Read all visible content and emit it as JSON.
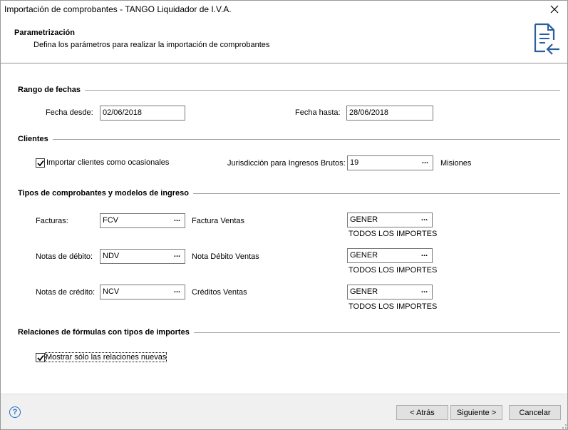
{
  "window": {
    "title": "Importación de comprobantes - TANGO Liquidador de I.V.A."
  },
  "header": {
    "title": "Parametrización",
    "subtitle": "Defina los parámetros para realizar la importación de comprobantes"
  },
  "rango_fechas": {
    "title": "Rango de fechas",
    "desde_label": "Fecha desde:",
    "desde_value": "02/06/2018",
    "hasta_label": "Fecha hasta:",
    "hasta_value": "28/06/2018"
  },
  "clientes": {
    "title": "Clientes",
    "importar_label": "Importar clientes como ocasionales",
    "importar_checked": true,
    "jurisdiccion_label": "Jurisdicción para Ingresos Brutos:",
    "jurisdiccion_value": "19",
    "jurisdiccion_desc": "Misiones"
  },
  "tipos": {
    "title": "Tipos de comprobantes y modelos de ingreso",
    "rows": [
      {
        "label": "Facturas:",
        "code": "FCV",
        "desc": "Factura Ventas",
        "modelo": "GENER",
        "modelo_desc": "TODOS LOS IMPORTES"
      },
      {
        "label": "Notas de débito:",
        "code": "NDV",
        "desc": "Nota Débito Ventas",
        "modelo": "GENER",
        "modelo_desc": "TODOS LOS IMPORTES"
      },
      {
        "label": "Notas de crédito:",
        "code": "NCV",
        "desc": "Créditos Ventas",
        "modelo": "GENER",
        "modelo_desc": "TODOS LOS IMPORTES"
      }
    ]
  },
  "relaciones": {
    "title": "Relaciones de fórmulas con tipos de importes",
    "mostrar_label": "Mostrar sólo las relaciones nuevas",
    "mostrar_checked": true
  },
  "footer": {
    "help": "?",
    "atras": "< Atrás",
    "siguiente": "Siguiente >",
    "cancelar": "Cancelar"
  },
  "colors": {
    "accent": "#1e6ec8",
    "icon": "#2a5f9e"
  }
}
